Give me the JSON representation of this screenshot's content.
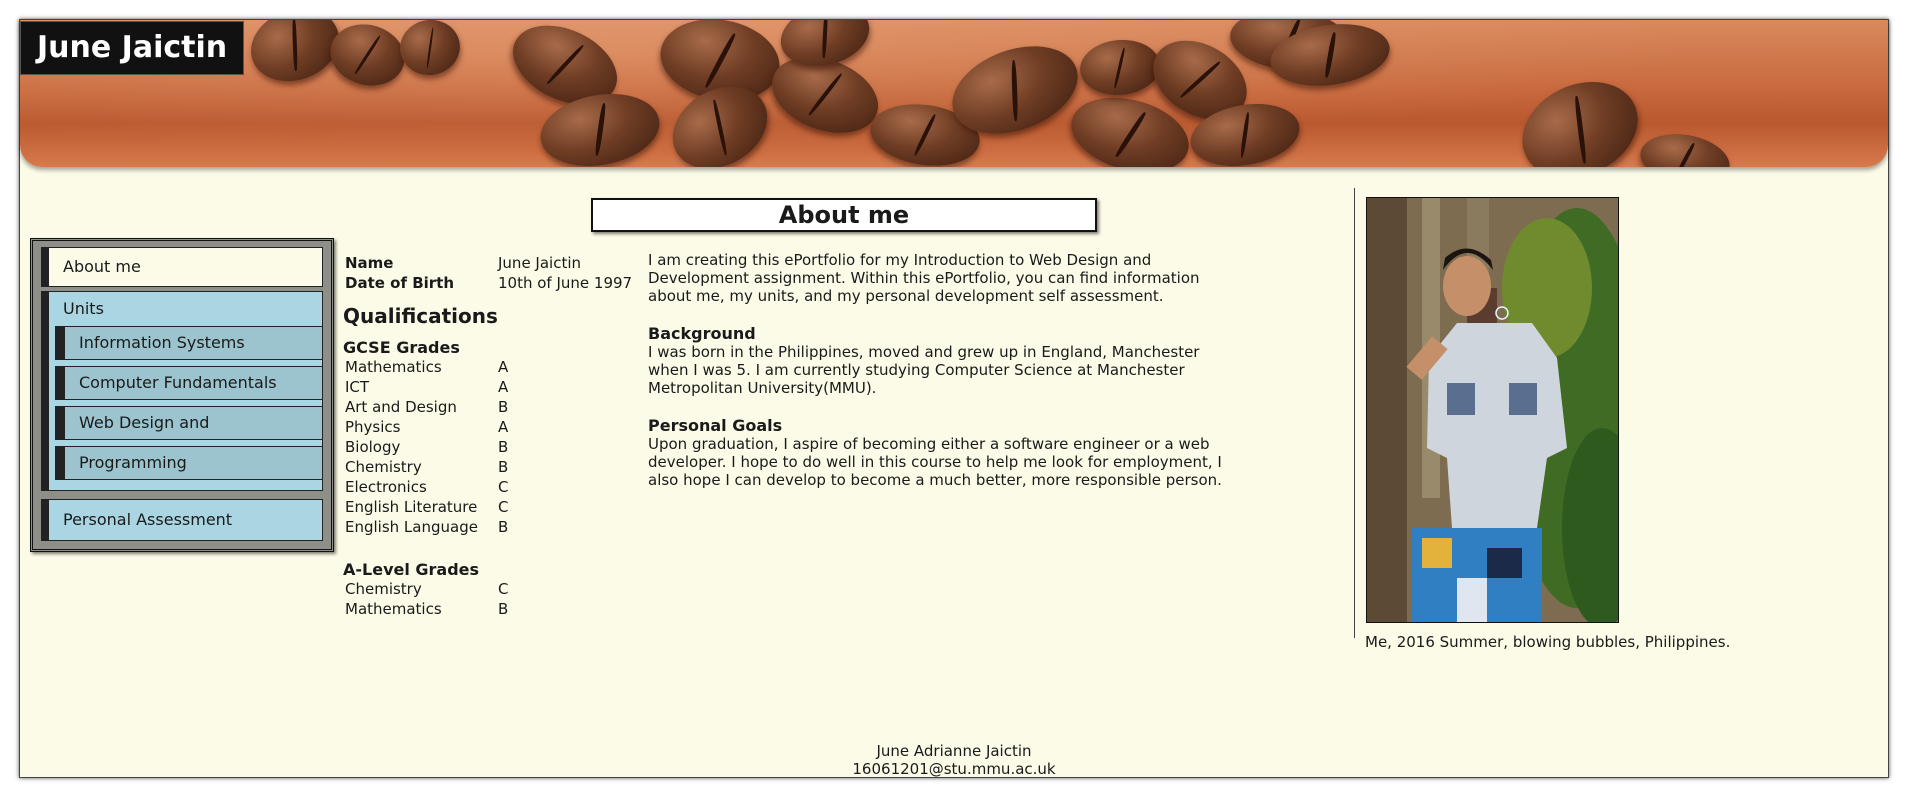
{
  "header": {
    "title": "June Jaictin"
  },
  "page": {
    "heading": "About me"
  },
  "nav": {
    "about": "About me",
    "units": "Units",
    "sub_items": [
      "Information Systems",
      "Computer Fundamentals",
      "Web Design and Development",
      "Programming"
    ],
    "personal": "Personal Assessment"
  },
  "profile": {
    "name_label": "Name",
    "name_value": "June Jaictin",
    "dob_label": "Date of Birth",
    "dob_value": "10th of June 1997"
  },
  "qualifications": {
    "heading": "Qualifications",
    "gcse_heading": "GCSE Grades",
    "gcse": [
      {
        "subject": "Mathematics",
        "grade": "A"
      },
      {
        "subject": "ICT",
        "grade": "A"
      },
      {
        "subject": "Art and Design",
        "grade": "B"
      },
      {
        "subject": "Physics",
        "grade": "A"
      },
      {
        "subject": "Biology",
        "grade": "B"
      },
      {
        "subject": "Chemistry",
        "grade": "B"
      },
      {
        "subject": "Electronics",
        "grade": "C"
      },
      {
        "subject": "English Literature",
        "grade": "C"
      },
      {
        "subject": "English Language",
        "grade": "B"
      }
    ],
    "alevel_heading": "A-Level Grades",
    "alevel": [
      {
        "subject": "Chemistry",
        "grade": "C"
      },
      {
        "subject": "Mathematics",
        "grade": "B"
      }
    ]
  },
  "about": {
    "intro": [
      "I am creating this ePortfolio for my Introduction to Web Design and",
      "Development assignment. Within this ePortfolio, you can find information",
      "about me, my units, and my personal development self assessment."
    ],
    "background_heading": "Background",
    "background": [
      "I was born in the Philippines, moved and grew up in England, Manchester",
      "when I was 5. I am currently studying Computer Science at Manchester",
      "Metropolitan University(MMU)."
    ],
    "goals_heading": "Personal Goals",
    "goals": [
      "Upon graduation, I aspire of becoming either a software engineer or a web",
      "developer. I hope to do well in this course to help me look for employment, I",
      "also hope I can develop to become a much better, more responsible person."
    ]
  },
  "photo": {
    "caption": "Me, 2016 Summer, blowing bubbles, Philippines."
  },
  "footer": {
    "name": "June Adrianne Jaictin",
    "email": "16061201@stu.mmu.ac.uk"
  }
}
